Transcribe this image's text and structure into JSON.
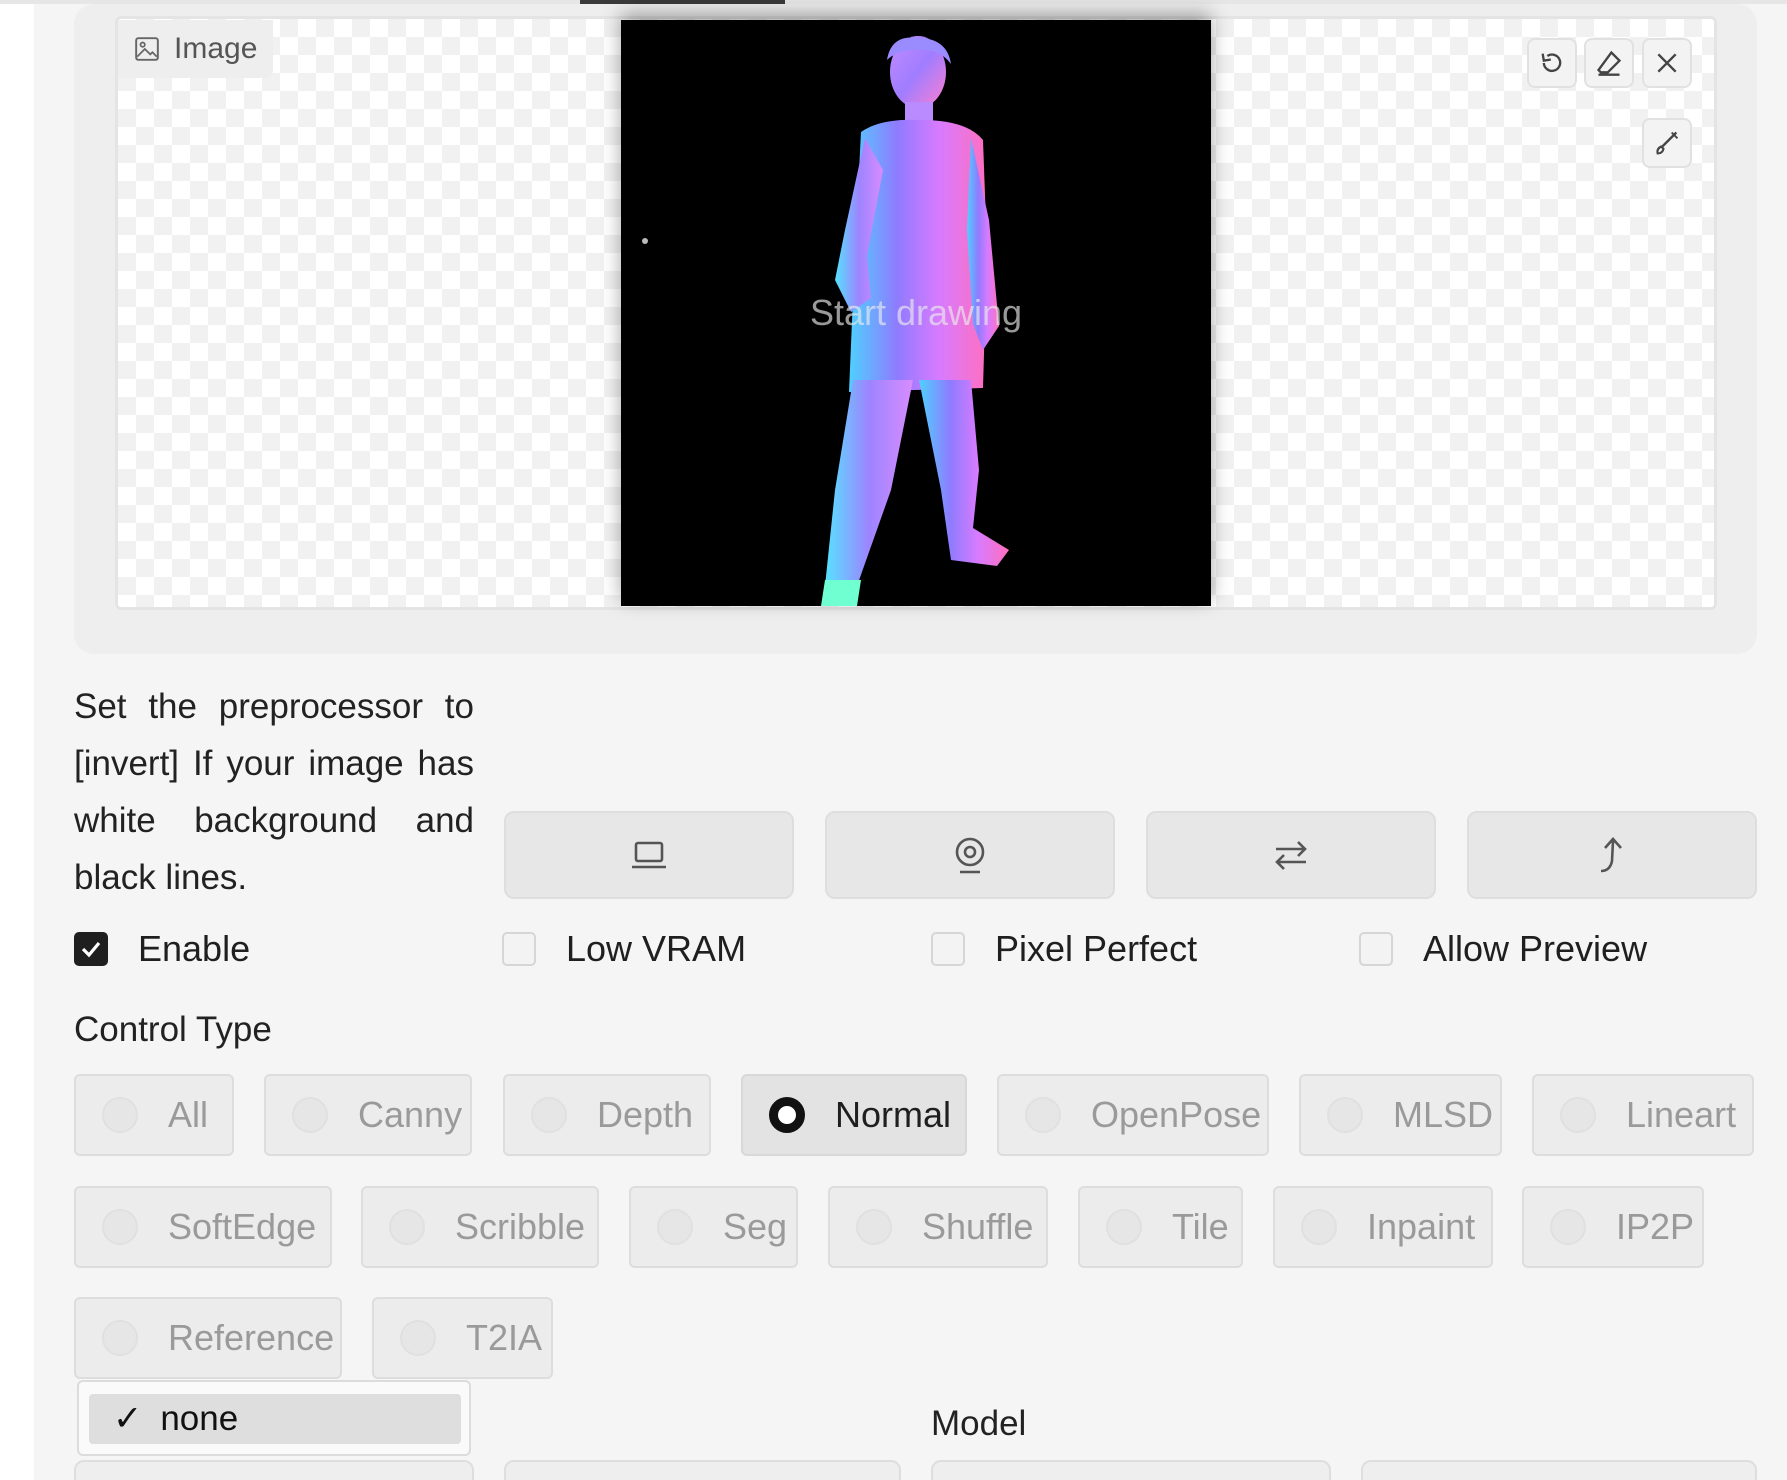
{
  "image_panel": {
    "label": "Image",
    "canvas_placeholder": "Start drawing",
    "tools": {
      "undo_icon": "undo-icon",
      "erase_icon": "eraser-icon",
      "close_icon": "close-icon",
      "brush_icon": "brush-icon"
    }
  },
  "hint_text": "Set the preprocessor to [invert] If your image has white background and black lines.",
  "action_buttons": [
    {
      "icon": "laptop-icon"
    },
    {
      "icon": "webcam-icon"
    },
    {
      "icon": "swap-icon"
    },
    {
      "icon": "send-up-icon"
    }
  ],
  "options": {
    "enable": {
      "label": "Enable",
      "checked": true
    },
    "low_vram": {
      "label": "Low VRAM",
      "checked": false
    },
    "pixel_perfect": {
      "label": "Pixel Perfect",
      "checked": false
    },
    "allow_preview": {
      "label": "Allow Preview",
      "checked": false
    }
  },
  "control_type": {
    "label": "Control Type",
    "selected": "Normal",
    "items": [
      "All",
      "Canny",
      "Depth",
      "Normal",
      "OpenPose",
      "MLSD",
      "Lineart",
      "SoftEdge",
      "Scribble",
      "Seg",
      "Shuffle",
      "Tile",
      "Inpaint",
      "IP2P",
      "Reference",
      "T2IA"
    ]
  },
  "preprocessor_dropdown": {
    "selected_option": "none",
    "check_mark": "✓"
  },
  "model": {
    "label": "Model"
  }
}
